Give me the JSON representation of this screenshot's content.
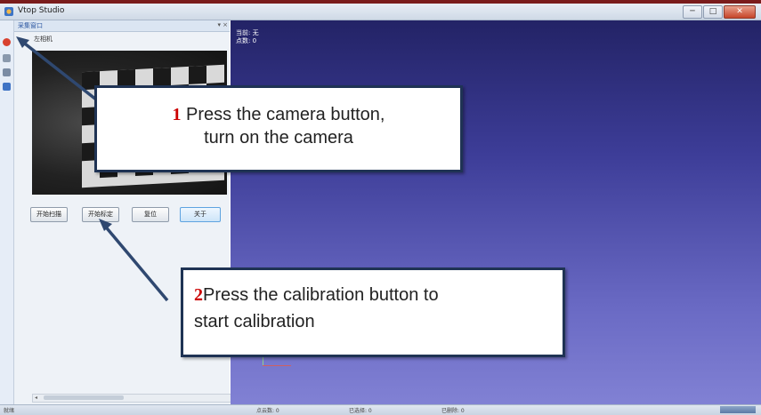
{
  "window": {
    "title": "Vtop Studio",
    "buttons": {
      "minimize": "─",
      "maximize": "□",
      "close": "✕"
    }
  },
  "panel": {
    "title": "采集窗口",
    "pin": "▾",
    "close": "×",
    "camera_label": "左相机",
    "buttons": {
      "start_scan": "开始扫描",
      "start_calibration": "开始标定",
      "reset": "复位",
      "about": "关于"
    }
  },
  "viewport": {
    "line1": "当前: 无",
    "line2": "点数: 0"
  },
  "statusbar": {
    "ready": "就绪",
    "points": "点云数: 0",
    "selected": "已选择: 0",
    "deleted": "已删除: 0"
  },
  "callout1": {
    "number": "1",
    "line1": " Press the camera button,",
    "line2": "turn on the camera"
  },
  "callout2": {
    "number": "2",
    "line1": "Press the calibration button to",
    "line2": "start calibration"
  },
  "colors": {
    "callout_border": "#1f3354",
    "arrow": "#2f4870",
    "callout_number": "#cc0000",
    "viewport_top": "#232366",
    "viewport_bottom": "#8181d4",
    "title_strip": "#7a1c1c"
  }
}
